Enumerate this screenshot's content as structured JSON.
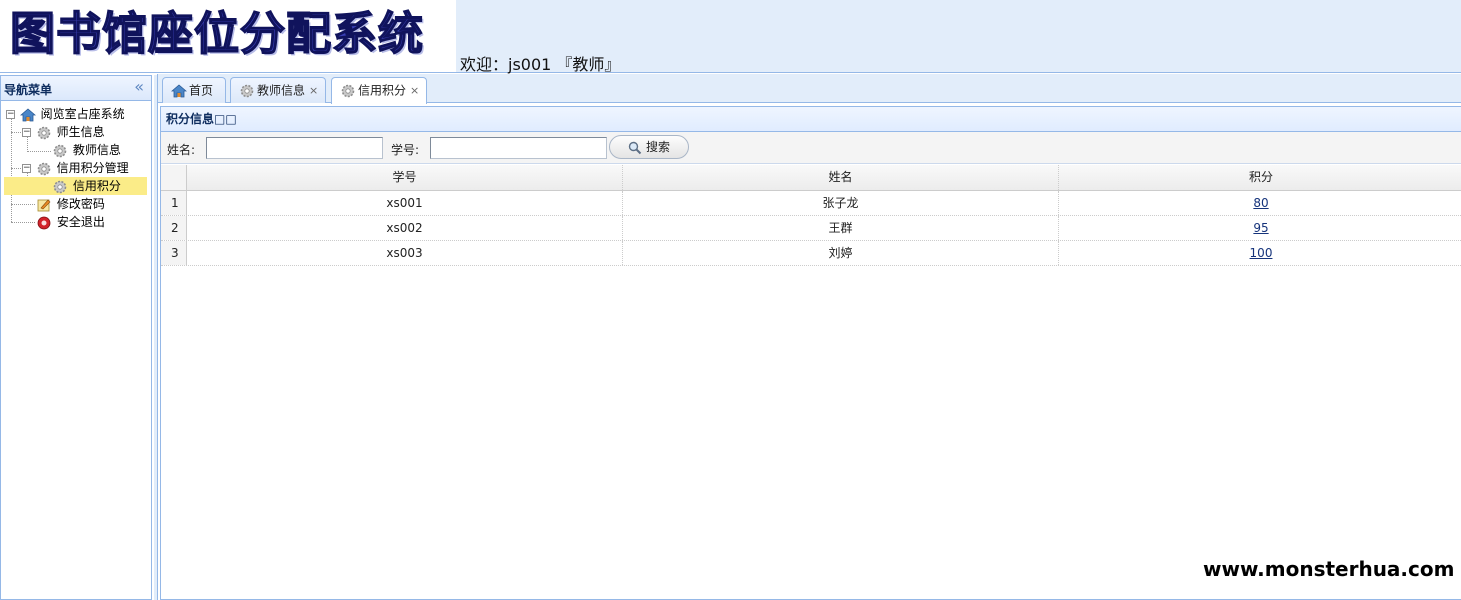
{
  "header": {
    "logo_text": "图书馆座位分配系统",
    "welcome": "欢迎：js001 『教师』"
  },
  "sidebar": {
    "title": "导航菜单",
    "collapse_glyph": "«",
    "tree": [
      {
        "label": "阅览室占座系统",
        "icon": "home-icon"
      },
      {
        "label": "师生信息",
        "icon": "gear-icon"
      },
      {
        "label": "教师信息",
        "icon": "gear-icon"
      },
      {
        "label": "信用积分管理",
        "icon": "gear-icon"
      },
      {
        "label": "信用积分",
        "icon": "gear-icon"
      },
      {
        "label": "修改密码",
        "icon": "edit-icon"
      },
      {
        "label": "安全退出",
        "icon": "exit-icon"
      }
    ]
  },
  "tabs": [
    {
      "label": "首页",
      "icon": "home-icon"
    },
    {
      "label": "教师信息",
      "icon": "gear-icon",
      "close": "×"
    },
    {
      "label": "信用积分",
      "icon": "gear-icon",
      "close": "×"
    }
  ],
  "panel": {
    "title": "积分信息□□",
    "toolbar": {
      "name_label": "姓名:",
      "name_value": "",
      "id_label": "学号:",
      "id_value": "",
      "search_label": "搜索"
    },
    "table": {
      "columns": [
        "学号",
        "姓名",
        "积分"
      ],
      "rows": [
        {
          "num": "1",
          "id": "xs001",
          "name": "张子龙",
          "score": "80"
        },
        {
          "num": "2",
          "id": "xs002",
          "name": "王群",
          "score": "95"
        },
        {
          "num": "3",
          "id": "xs003",
          "name": "刘婷",
          "score": "100"
        }
      ]
    }
  },
  "watermark": "www.monsterhua.com",
  "colors": {
    "border": "#95b8e7",
    "header_bg": "#e2edfa",
    "selected_bg": "#fbec88",
    "link": "#15337b"
  }
}
